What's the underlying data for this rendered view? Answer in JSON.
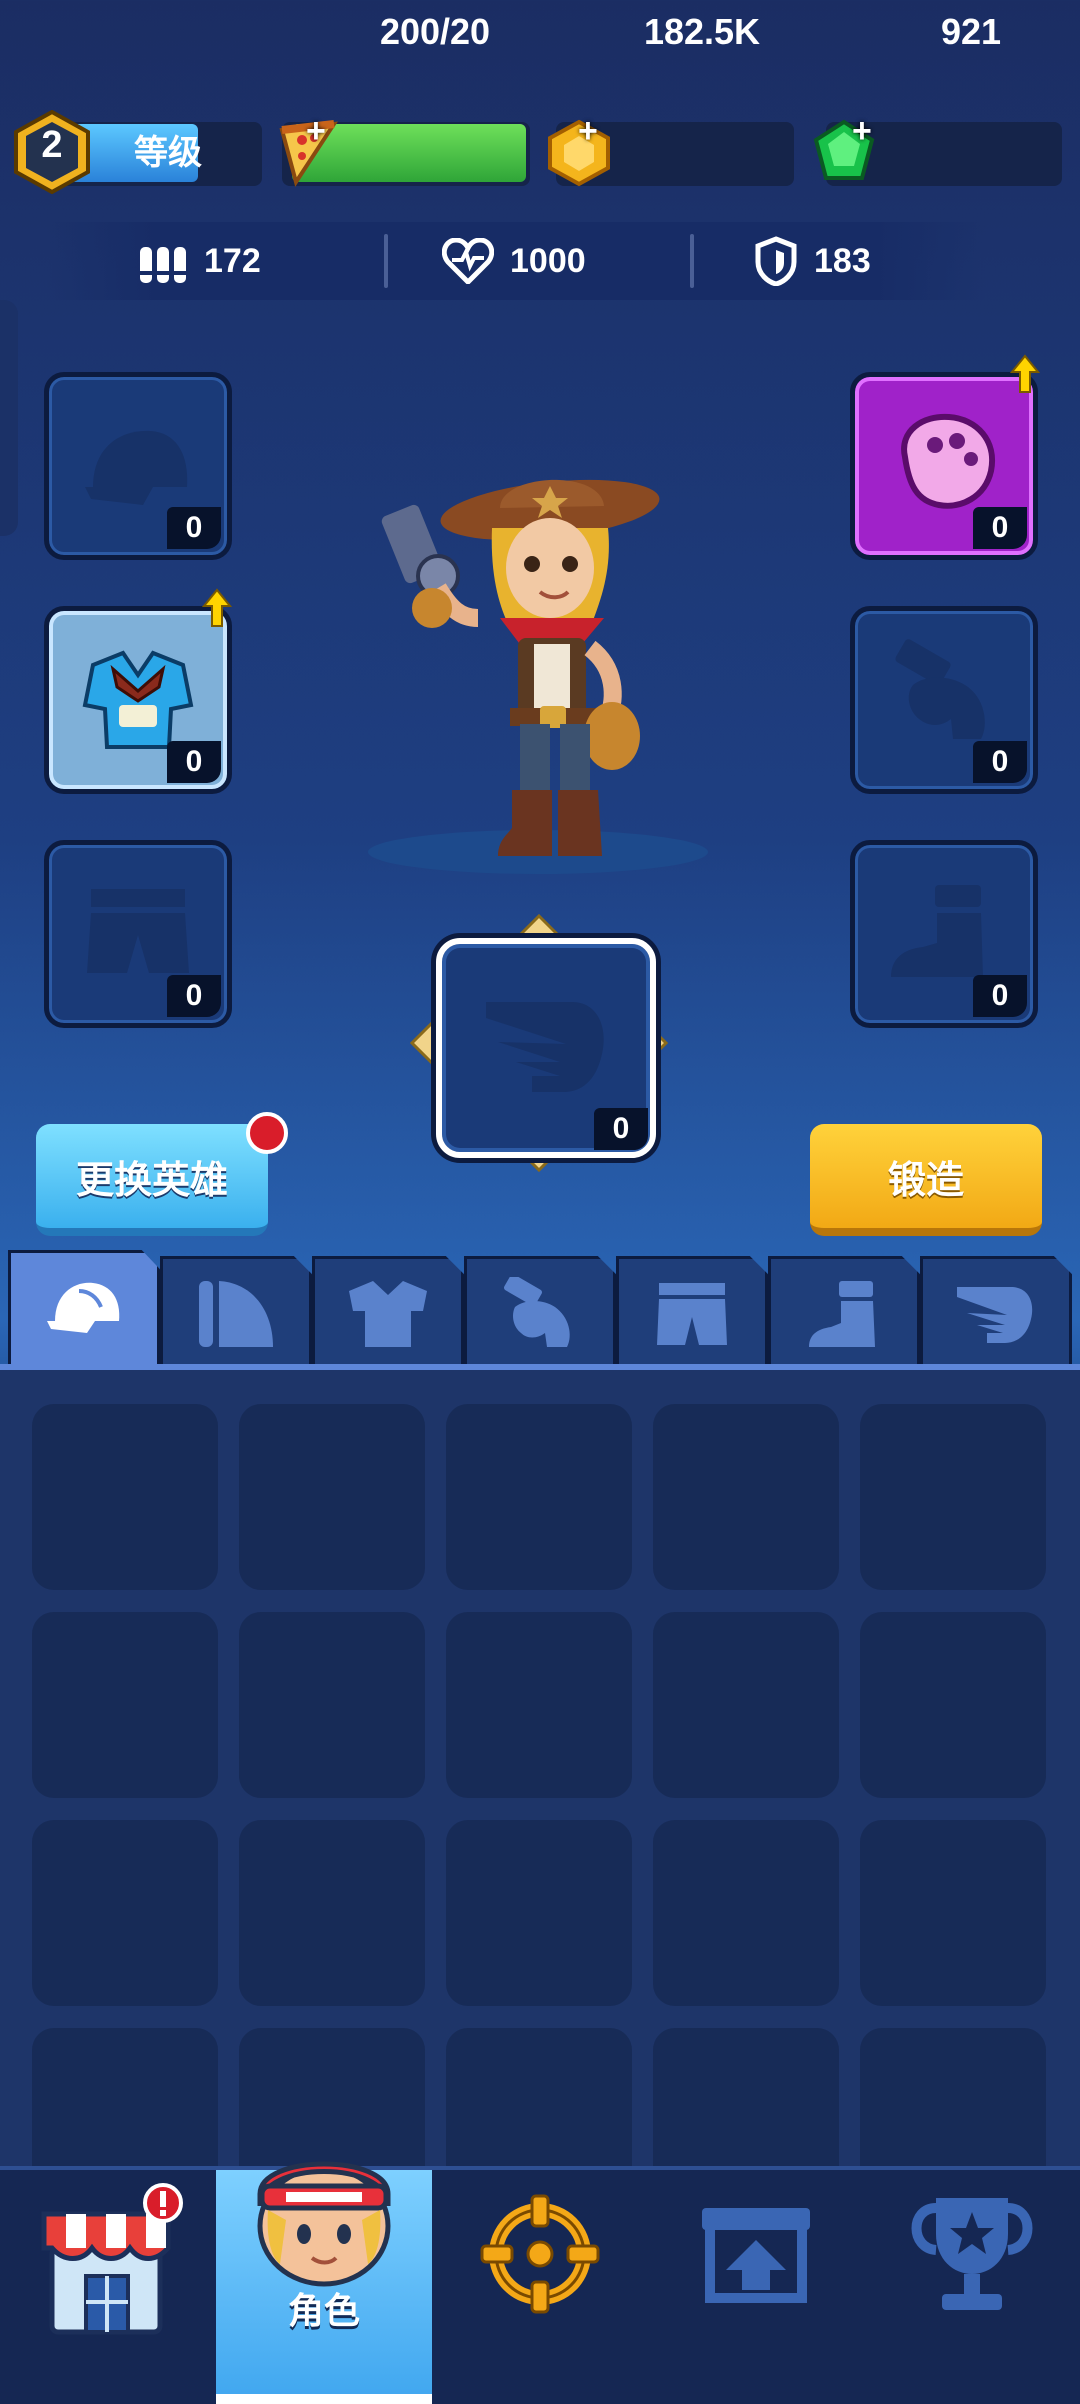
{
  "topbar": {
    "level": "2",
    "level_label": "等级",
    "energy": "200/20",
    "gold": "182.5K",
    "gems": "921"
  },
  "stats": {
    "ammo": "172",
    "health": "1000",
    "armor": "183"
  },
  "equipment": {
    "hat_count": "0",
    "armor_count": "0",
    "pants_count": "0",
    "ring_count": "0",
    "glove_count": "0",
    "boots_count": "0",
    "wings_count": "0"
  },
  "buttons": {
    "change_hero": "更换英雄",
    "forge": "锻造"
  },
  "tabs": [
    "hat-icon",
    "shoulder-icon",
    "shirt-icon",
    "glove-icon",
    "pants-icon",
    "boot-icon",
    "wing-icon"
  ],
  "active_tab": 0,
  "bottom_nav": {
    "shop_icon": "shop-icon",
    "character_label": "角色",
    "battle_icon": "crosshair-icon",
    "upgrade_icon": "upgrade-icon",
    "trophy_icon": "trophy-icon"
  },
  "colors": {
    "energy_bar": "#2fa538",
    "level_bar": "#2a82d9",
    "gem": "#18c24a",
    "gold": "#f4b51c",
    "forge_button": "#f2a915",
    "hero_button": "#3ab0ee"
  }
}
